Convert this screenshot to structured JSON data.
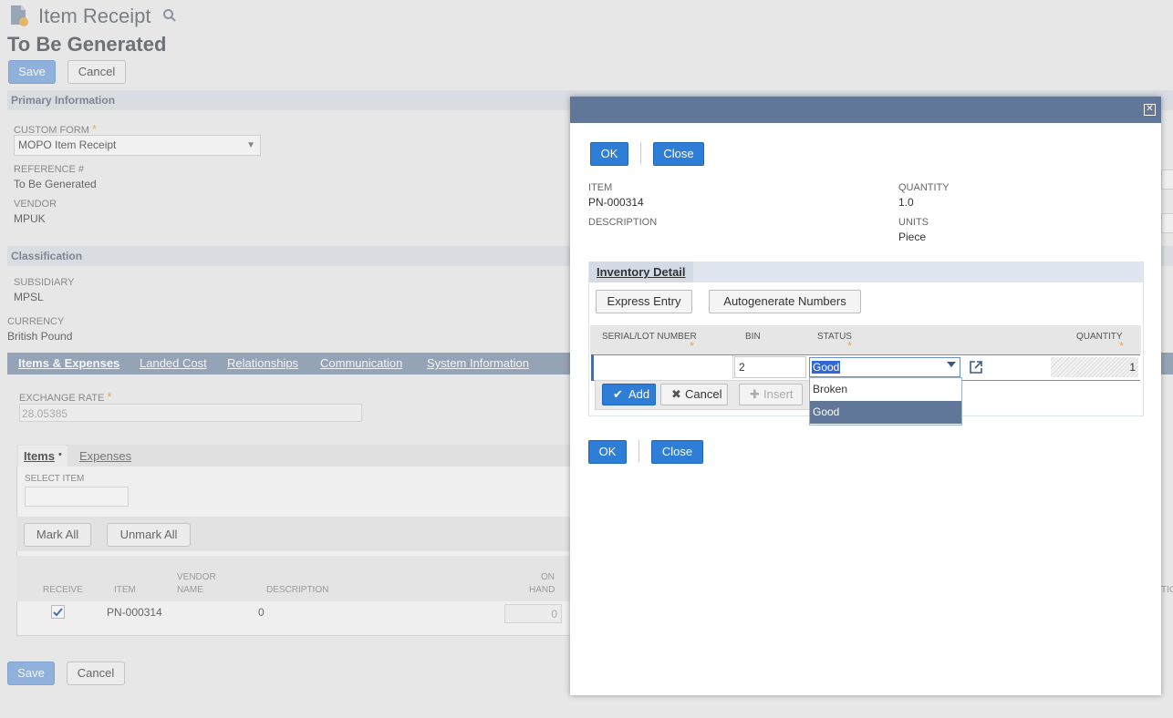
{
  "page": {
    "title": "Item Receipt",
    "subtitle": "To Be Generated",
    "save_label": "Save",
    "cancel_label": "Cancel"
  },
  "primary": {
    "section_title": "Primary Information",
    "custom_form_label": "CUSTOM FORM",
    "custom_form_value": "MOPO Item Receipt",
    "reference_label": "REFERENCE #",
    "reference_value": "To Be Generated",
    "vendor_label": "VENDOR",
    "vendor_value": "MPUK"
  },
  "classification": {
    "section_title": "Classification",
    "subsidiary_label": "SUBSIDIARY",
    "subsidiary_value": "MPSL",
    "currency_label": "CURRENCY",
    "currency_value": "British Pound"
  },
  "tabs": [
    "Items & Expenses",
    "Landed Cost",
    "Relationships",
    "Communication",
    "System Information"
  ],
  "exchange": {
    "label": "EXCHANGE RATE",
    "value": "28.05385"
  },
  "subtabs": [
    "Items",
    "Expenses"
  ],
  "items_bullet": "•",
  "select_item_label": "SELECT ITEM",
  "mark_all_label": "Mark All",
  "unmark_all_label": "Unmark All",
  "items_table": {
    "headers": [
      "RECEIVE",
      "ITEM",
      "VENDOR",
      "NAME",
      "DESCRIPTION",
      "ON",
      "HAND",
      "TIO"
    ],
    "row": {
      "item": "PN-000314",
      "description": "0",
      "on_hand": "0"
    }
  },
  "modal": {
    "close_glyph": "✕",
    "ok_label": "OK",
    "close_label": "Close",
    "item_label": "ITEM",
    "item_value": "PN-000314",
    "description_label": "DESCRIPTION",
    "quantity_label": "QUANTITY",
    "quantity_value": "1.0",
    "units_label": "UNITS",
    "units_value": "Piece",
    "inventory_tab": "Inventory Detail",
    "express_entry_label": "Express Entry",
    "autogenerate_label": "Autogenerate Numbers",
    "grid_headers": {
      "serial": "SERIAL/LOT NUMBER",
      "bin": "BIN",
      "status": "STATUS",
      "quantity": "QUANTITY"
    },
    "row": {
      "serial": "",
      "bin": "2",
      "status": "Good",
      "quantity": "1"
    },
    "status_options": [
      "Broken",
      "Good"
    ],
    "add_label": "Add",
    "cancel_label": "Cancel",
    "insert_label": "Insert"
  },
  "colors": {
    "modal_header": "#607799",
    "primary_button": "#2e7ed8",
    "required_star": "#e6a96b"
  }
}
